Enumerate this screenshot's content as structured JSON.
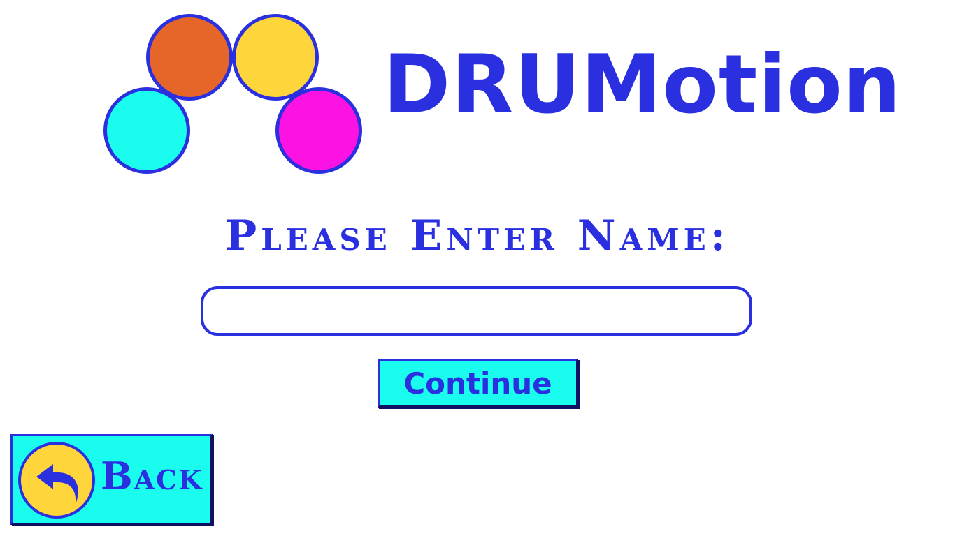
{
  "app": {
    "brand_name": "DRUMotion"
  },
  "logo": {
    "circles": [
      {
        "name": "orange",
        "color": "#e6662a"
      },
      {
        "name": "yellow",
        "color": "#ffd53c"
      },
      {
        "name": "cyan",
        "color": "#1afcee"
      },
      {
        "name": "magenta",
        "color": "#fd12e4"
      }
    ],
    "outline_color": "#2a2fe0"
  },
  "form": {
    "prompt": "Please Enter Name:",
    "name_value": "",
    "name_placeholder": ""
  },
  "buttons": {
    "continue_label": "Continue",
    "back_label": "Back",
    "back_icon": "back-arrow-icon"
  },
  "colors": {
    "accent": "#2a2fe0",
    "button_bg": "#1afcee",
    "background": "#ffffff"
  }
}
